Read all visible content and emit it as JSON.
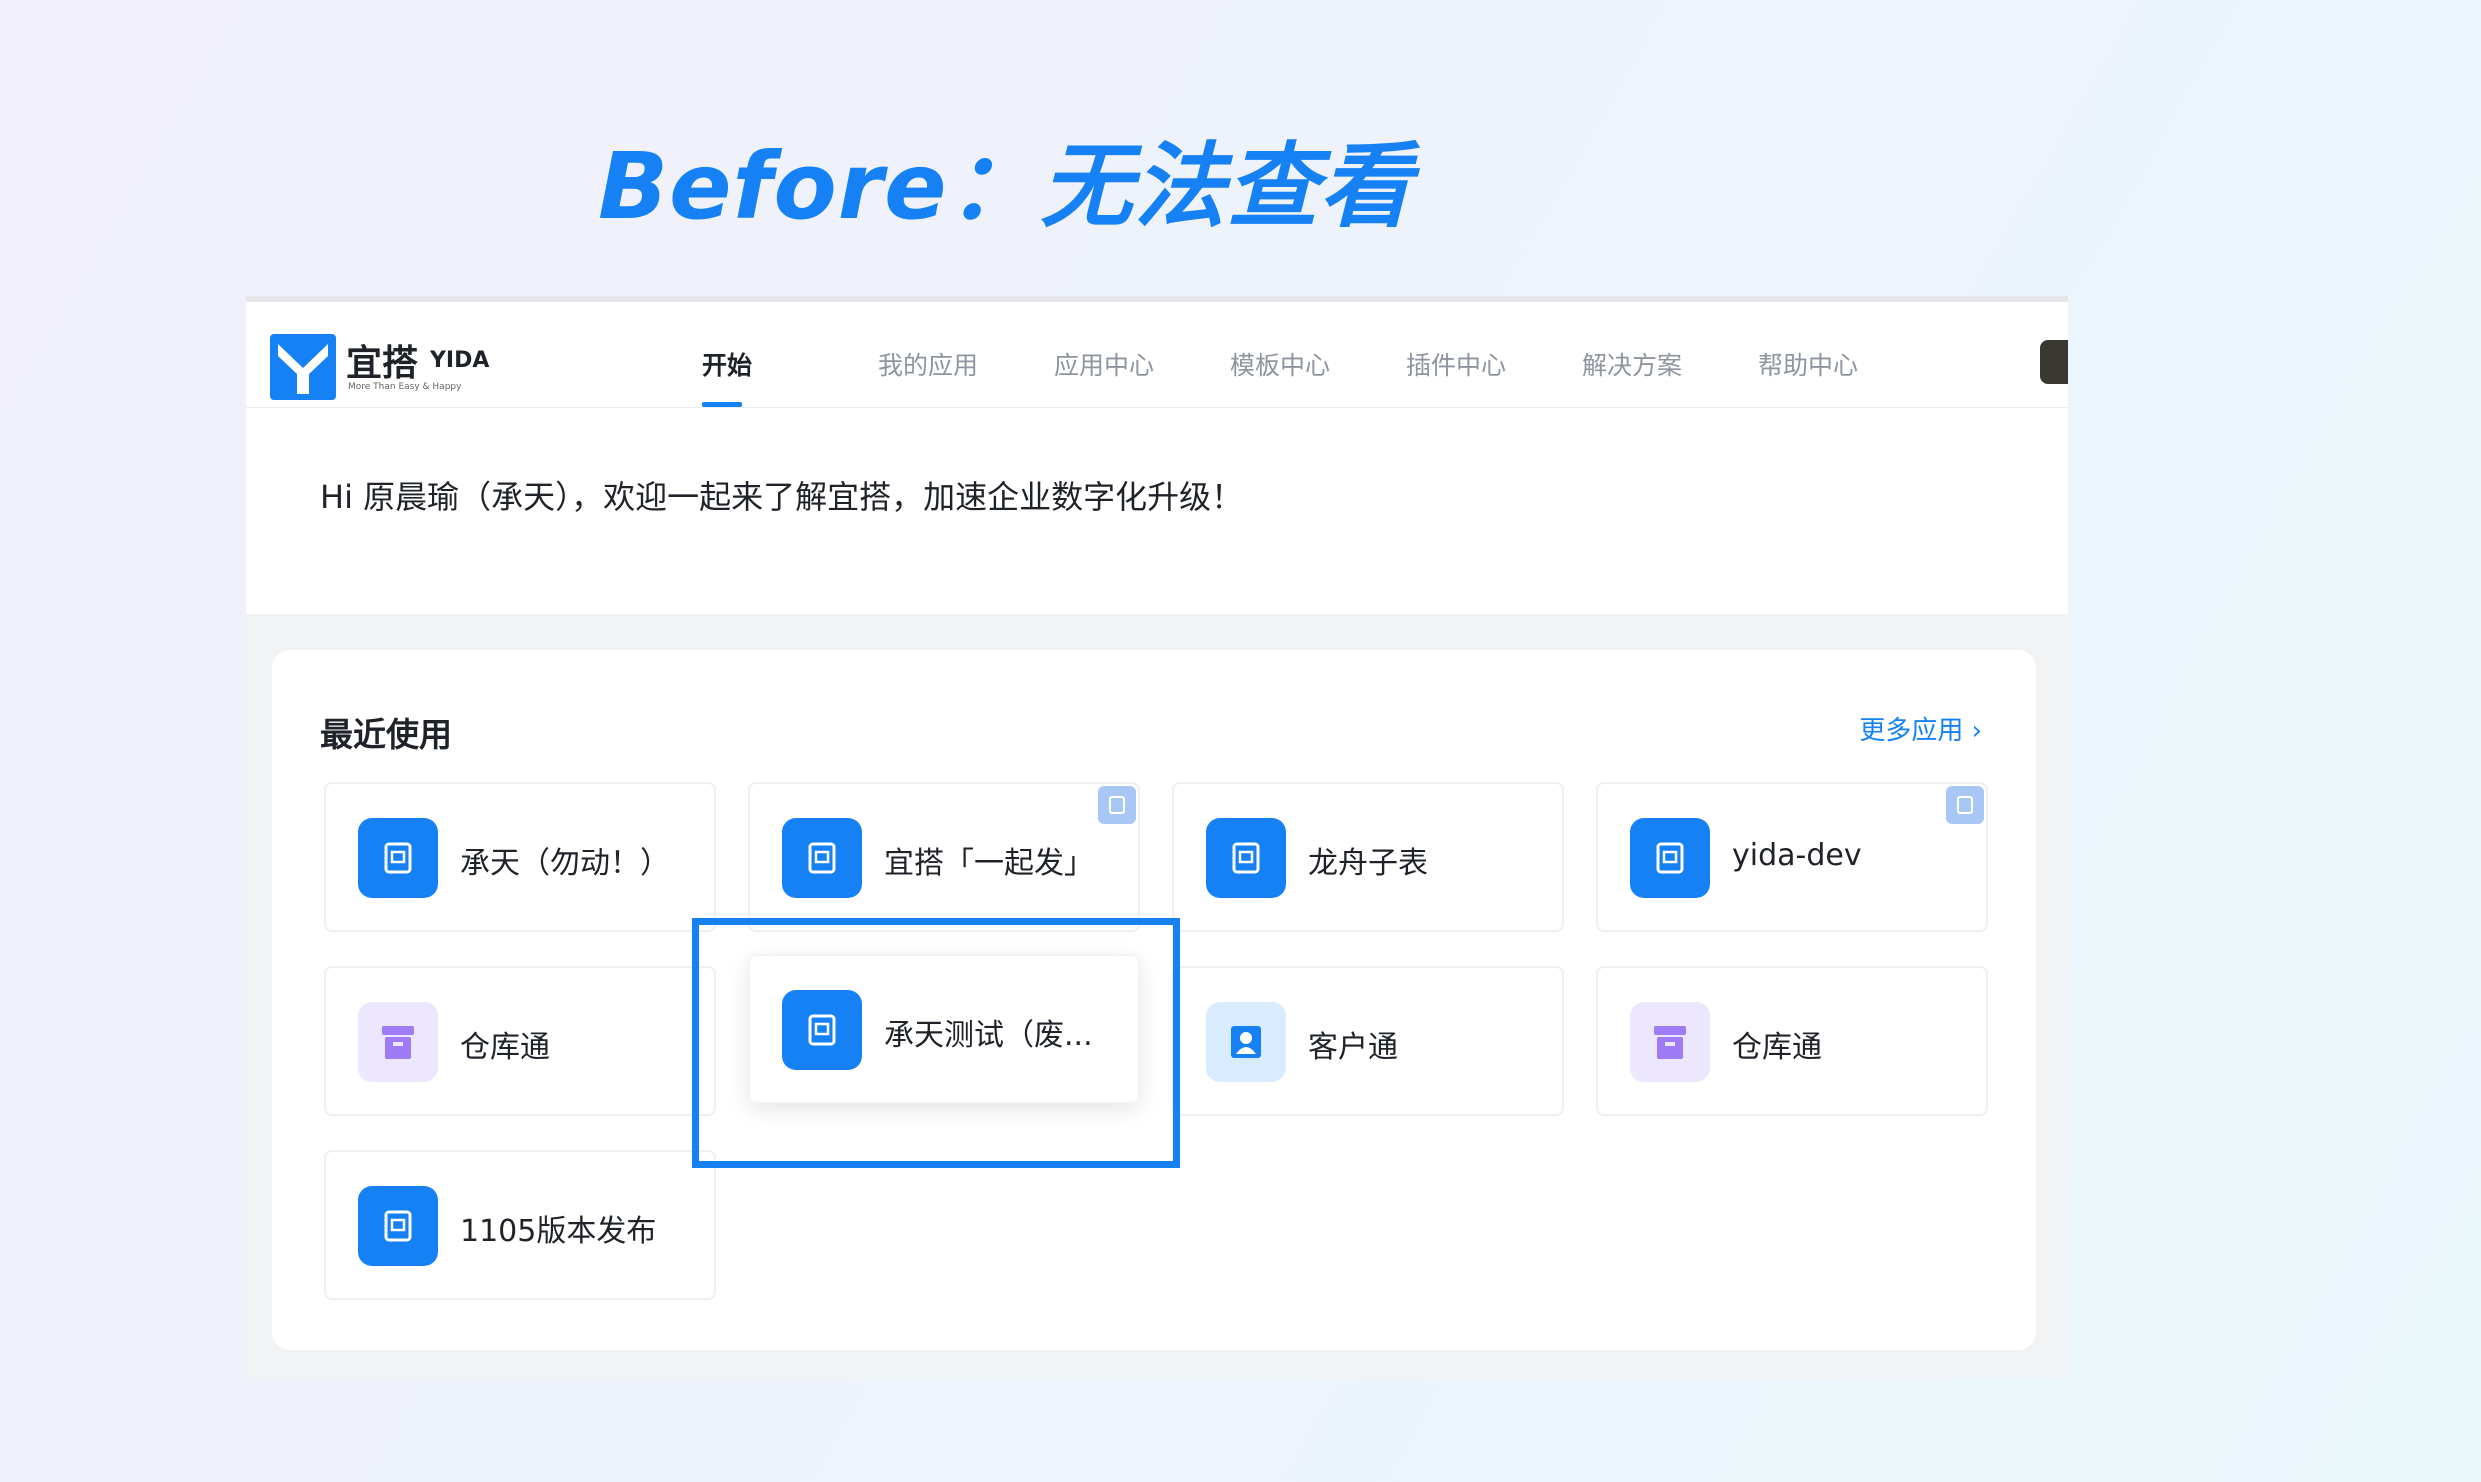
{
  "heading": "Before：无法查看",
  "logo": {
    "cn": "宜搭",
    "en": "YIDA",
    "sub": "More Than Easy & Happy"
  },
  "nav": [
    {
      "label": "开始",
      "active": true
    },
    {
      "label": "我的应用",
      "active": false
    },
    {
      "label": "应用中心",
      "active": false
    },
    {
      "label": "模板中心",
      "active": false
    },
    {
      "label": "插件中心",
      "active": false
    },
    {
      "label": "解决方案",
      "active": false
    },
    {
      "label": "帮助中心",
      "active": false
    }
  ],
  "welcome": "Hi 原晨瑜（承天），欢迎一起来了解宜搭，加速企业数字化升级！",
  "recent": {
    "title": "最近使用",
    "more": "更多应用 ›",
    "tiles": [
      {
        "label": "承天（勿动！）",
        "icon": "form-icon",
        "color": "blue",
        "badge": false
      },
      {
        "label": "宜搭「一起发」",
        "icon": "form-icon",
        "color": "blue",
        "badge": true
      },
      {
        "label": "龙舟子表",
        "icon": "form-icon",
        "color": "blue",
        "badge": false
      },
      {
        "label": "yida-dev",
        "icon": "form-icon",
        "color": "blue",
        "badge": true
      },
      {
        "label": "仓库通",
        "icon": "warehouse-icon",
        "color": "purple",
        "badge": false
      },
      {
        "label": "承天测试（废...",
        "icon": "form-icon",
        "color": "blue",
        "badge": false
      },
      {
        "label": "客户通",
        "icon": "contact-icon",
        "color": "lightblue",
        "badge": false
      },
      {
        "label": "仓库通",
        "icon": "warehouse-icon",
        "color": "purple",
        "badge": false
      },
      {
        "label": "1105版本发布",
        "icon": "form-icon",
        "color": "blue",
        "badge": false
      }
    ]
  },
  "colors": {
    "accent": "#1681f5",
    "highlight": "#1681f5"
  }
}
